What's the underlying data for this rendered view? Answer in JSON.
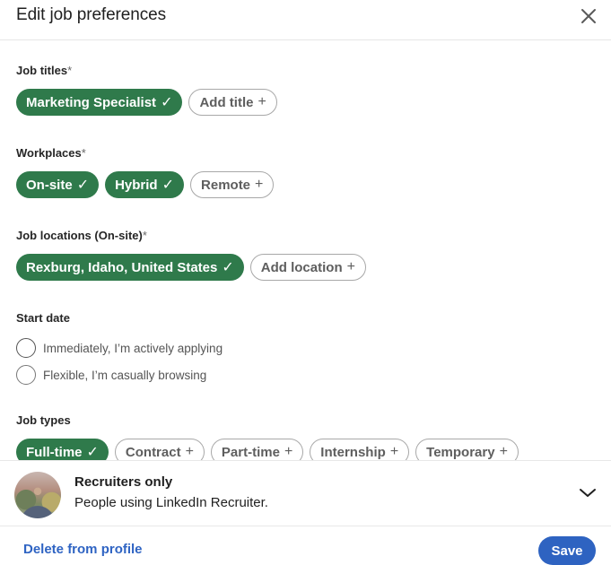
{
  "header": {
    "title": "Edit job preferences",
    "close_icon": "close-icon"
  },
  "job_titles": {
    "label": "Job titles",
    "required_mark": "*",
    "chips": [
      {
        "label": "Marketing Specialist",
        "selected": true,
        "glyph": "✓"
      },
      {
        "label": "Add title",
        "selected": false,
        "glyph": "+"
      }
    ]
  },
  "workplaces": {
    "label": "Workplaces",
    "required_mark": "*",
    "chips": [
      {
        "label": "On-site",
        "selected": true,
        "glyph": "✓"
      },
      {
        "label": "Hybrid",
        "selected": true,
        "glyph": "✓"
      },
      {
        "label": "Remote",
        "selected": false,
        "glyph": "+"
      }
    ]
  },
  "job_locations": {
    "label": "Job locations (On-site)",
    "required_mark": "*",
    "chips": [
      {
        "label": "Rexburg, Idaho, United States",
        "selected": true,
        "glyph": "✓"
      },
      {
        "label": "Add location",
        "selected": false,
        "glyph": "+"
      }
    ]
  },
  "start_date": {
    "label": "Start date",
    "options": [
      {
        "label": "Immediately, I’m actively applying",
        "selected": false
      },
      {
        "label": "Flexible, I’m casually browsing",
        "selected": false
      }
    ]
  },
  "job_types": {
    "label": "Job types",
    "chips": [
      {
        "label": "Full-time",
        "selected": true,
        "glyph": "✓"
      },
      {
        "label": "Contract",
        "selected": false,
        "glyph": "+"
      },
      {
        "label": "Part-time",
        "selected": false,
        "glyph": "+"
      },
      {
        "label": "Internship",
        "selected": false,
        "glyph": "+"
      },
      {
        "label": "Temporary",
        "selected": false,
        "glyph": "+"
      }
    ]
  },
  "visibility": {
    "title": "Recruiters only",
    "subtitle": "People using LinkedIn Recruiter.",
    "expand_icon": "chevron-down-icon"
  },
  "footer": {
    "delete_label": "Delete from profile",
    "save_label": "Save"
  },
  "colors": {
    "selected_chip": "#2f7a4b",
    "primary_button": "#2e63c1",
    "link": "#2f64c3"
  }
}
